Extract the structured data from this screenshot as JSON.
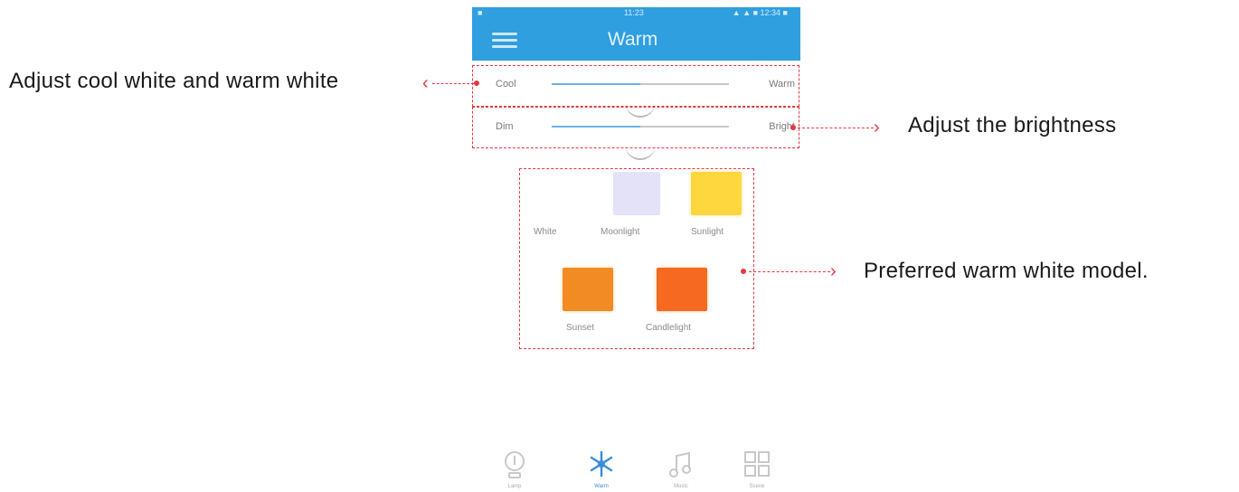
{
  "annotations": {
    "cool_warm": "Adjust cool white and warm white",
    "brightness": "Adjust the brightness",
    "warm_model": "Preferred warm white model."
  },
  "statusbar": {
    "left": "■",
    "time": "11:23",
    "right": "▲ ▲ ■ 12:34 ■"
  },
  "appbar": {
    "title": "Warm"
  },
  "sliders": {
    "temperature": {
      "left_label": "Cool",
      "right_label": "Warm",
      "value_fraction": 0.5
    },
    "brightness": {
      "left_label": "Dim",
      "right_label": "Bright",
      "value_fraction": 0.5
    }
  },
  "presets": [
    {
      "label": "White",
      "color": "#ffffff"
    },
    {
      "label": "Moonlight",
      "color": "#e3e2f8"
    },
    {
      "label": "Sunlight",
      "color": "#fed73f"
    },
    {
      "label": "Sunset",
      "color": "#f38b24"
    },
    {
      "label": "Candlelight",
      "color": "#f56a20"
    }
  ],
  "nav": [
    {
      "label": "Lamp",
      "icon": "bulb-icon"
    },
    {
      "label": "Warm",
      "icon": "snowflake-icon",
      "active": true
    },
    {
      "label": "Music",
      "icon": "music-icon"
    },
    {
      "label": "Scene",
      "icon": "grid-icon"
    }
  ],
  "colors": {
    "accent": "#2f9fe0",
    "callout": "#e5383f",
    "nav_active": "#3b8fd8",
    "nav_inactive": "#c8c8c8"
  }
}
